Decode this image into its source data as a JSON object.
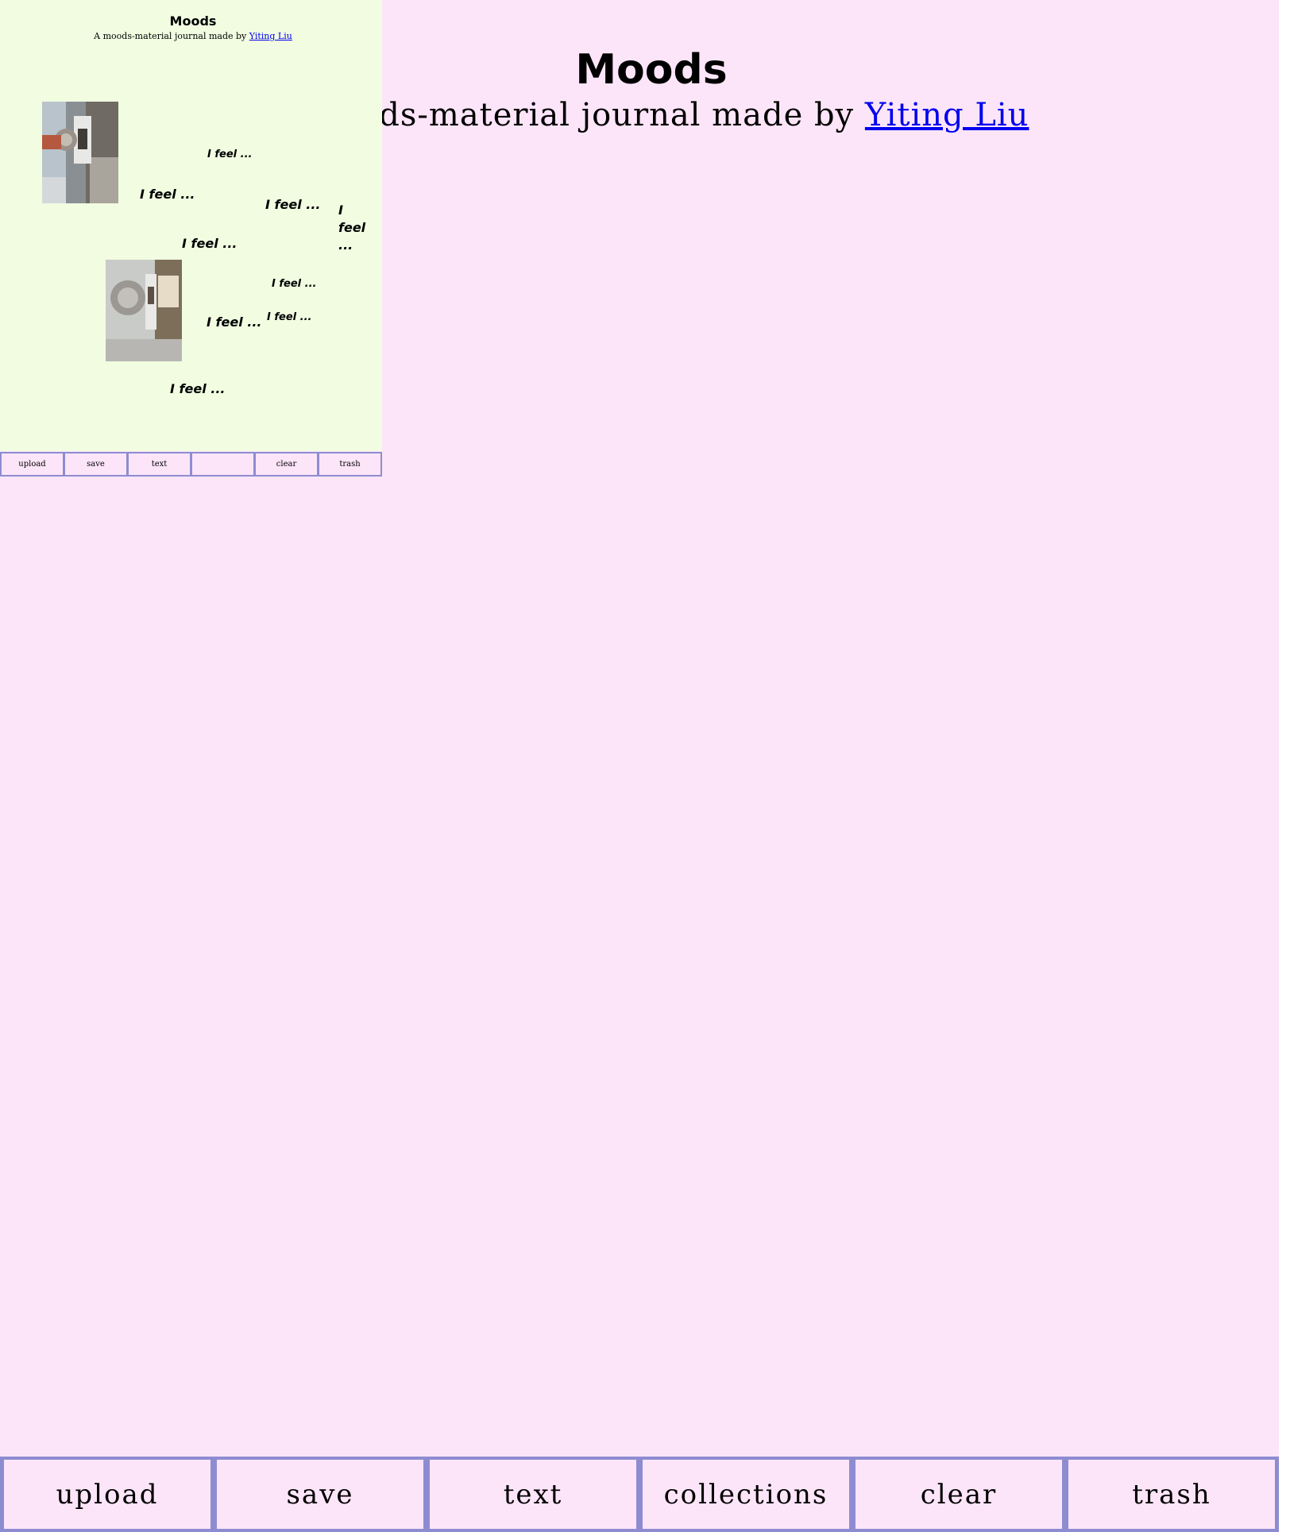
{
  "app": {
    "title": "Moods",
    "subtitle_prefix": "A moods-material journal made by ",
    "author_link": "Yiting Liu"
  },
  "toolbar": {
    "upload": "upload",
    "save": "save",
    "text": "text",
    "collections": "collections",
    "clear": "clear",
    "trash": "trash"
  },
  "thumbnail": {
    "title": "Moods",
    "subtitle_prefix": "A moods-material journal made by ",
    "author_link": "Yiting Liu",
    "notes": [
      "I feel ...",
      "I feel ...",
      "I feel ...",
      "I feel ...",
      "I feel ...",
      "I feel ...",
      "I feel ...",
      "I feel ...",
      "I feel ..."
    ],
    "toolbar": {
      "upload": "upload",
      "save": "save",
      "text": "text",
      "collections": "",
      "clear": "clear",
      "trash": "trash"
    }
  },
  "colors": {
    "page_background": "#fde5f9",
    "thumbnail_canvas": "#f1fce1",
    "toolbar_frame": "#8e8cd1",
    "link": "#0000ee"
  },
  "icons": {
    "photo_1": "door-knob-photo",
    "photo_2": "door-knob-photo"
  }
}
